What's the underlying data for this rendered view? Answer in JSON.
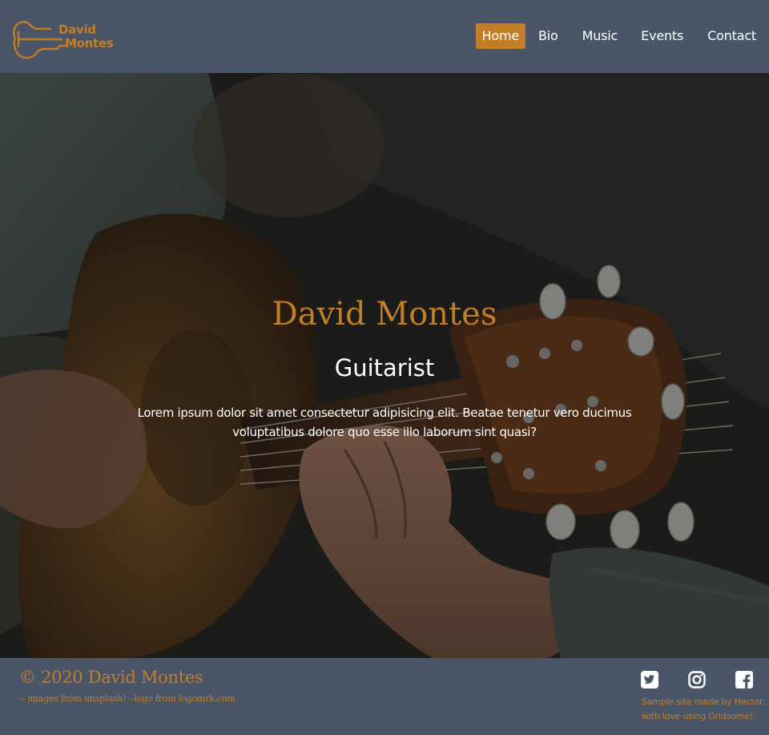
{
  "brand": {
    "logo_line1": "David",
    "logo_line2": "Montes",
    "accent_color": "#c27d27"
  },
  "nav": {
    "items": [
      {
        "label": "Home",
        "active": true
      },
      {
        "label": "Bio",
        "active": false
      },
      {
        "label": "Music",
        "active": false
      },
      {
        "label": "Events",
        "active": false
      },
      {
        "label": "Contact",
        "active": false
      }
    ]
  },
  "hero": {
    "title": "David Montes",
    "subtitle": "Guitarist",
    "text": "Lorem ipsum dolor sit amet consectetur adipisicing elit. Beatae tenetur vero ducimus voluptatibus dolore quo esse illo laborum sint quasi?",
    "background_image": "guitarist-playing-acoustic-guitar-photo"
  },
  "footer": {
    "copyright": "© 2020 David Montes",
    "credits": "-- images from unsplash! --logo from logomrk.com",
    "made_by": "Sample site made by Hector, with love using Gridsome!",
    "social": [
      {
        "icon": "twitter-icon"
      },
      {
        "icon": "instagram-icon"
      },
      {
        "icon": "facebook-icon"
      }
    ]
  },
  "colors": {
    "header_bg": "#4b5568",
    "footer_bg": "#4a5568",
    "text_light": "#ffffff"
  }
}
